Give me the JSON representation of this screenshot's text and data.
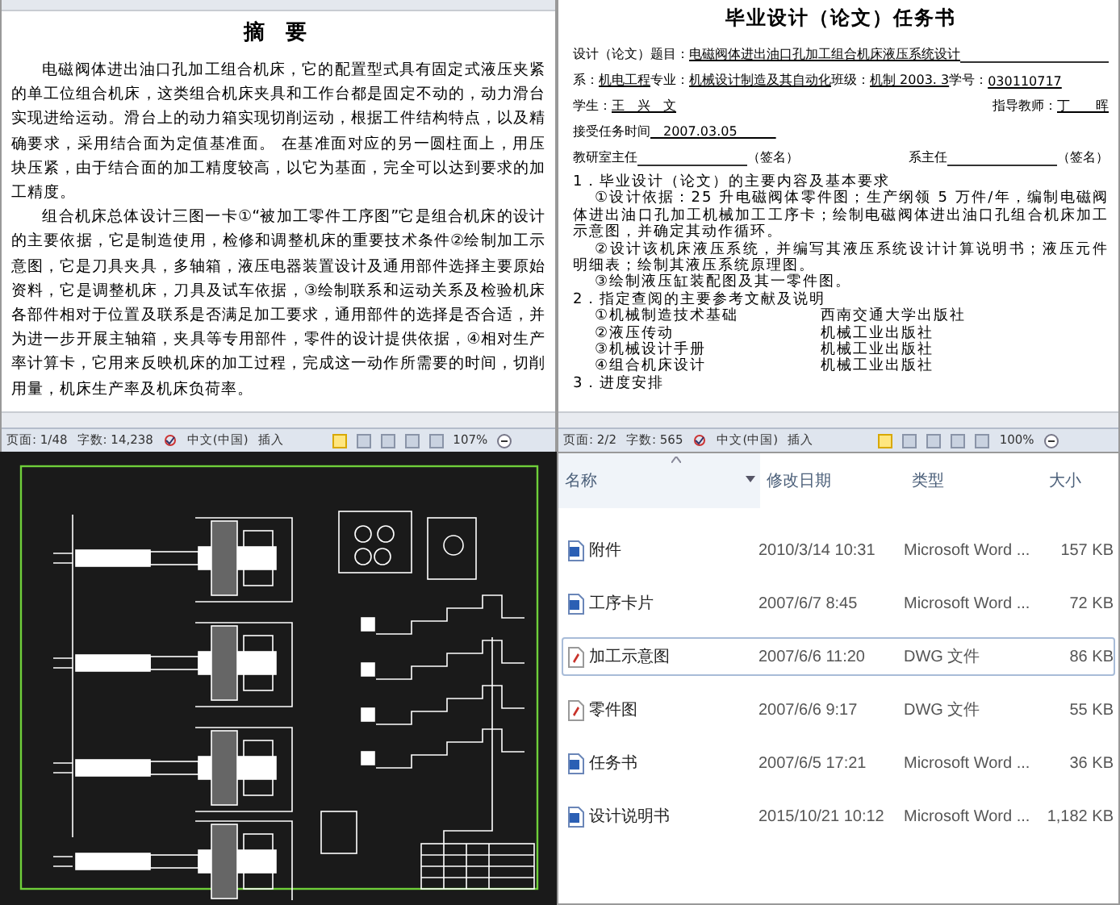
{
  "abstract_doc": {
    "title": "摘 要",
    "paragraphs": [
      "电磁阀体进出油口孔加工组合机床，它的配置型式具有固定式液压夹紧的单工位组合机床，这类组合机床夹具和工作台都是固定不动的，动力滑台实现进给运动。滑台上的动力箱实现切削运动，根据工件结构特点，以及精确要求，采用结合面为定值基准面。 在基准面对应的另一圆柱面上，用压块压紧，由于结合面的加工精度较高，以它为基面，完全可以达到要求的加工精度。",
      "组合机床总体设计三图一卡①“被加工零件工序图”它是组合机床的设计的主要依据，它是制造使用，检修和调整机床的重要技术条件②绘制加工示意图，它是刀具夹具，多轴箱，液压电器装置设计及通用部件选择主要原始资料，它是调整机床，刀具及试车依据，③绘制联系和运动关系及检验机床各部件相对于位置及联系是否满足加工要求，通用部件的选择是否合适，并为进一步开展主轴箱，夹具等专用部件，零件的设计提供依据，④相对生产率计算卡，它用来反映机床的加工过程，完成这一动作所需要的时间，切削用量，机床生产率及机床负荷率。"
    ],
    "status_bar": {
      "page": "页面: 1/48",
      "words": "字数: 14,238",
      "language": "中文(中国)",
      "mode": "插入",
      "zoom": "107%",
      "view_modes": [
        {
          "selected": true
        },
        {
          "selected": false
        },
        {
          "selected": false
        },
        {
          "selected": false
        },
        {
          "selected": false
        }
      ]
    }
  },
  "task_doc": {
    "title": "毕业设计（论文）任务书",
    "fields": [
      [
        {
          "kind": "text",
          "text": "设计（论文）题目："
        },
        {
          "kind": "filled",
          "text": "电磁阀体进出油口孔加工组合机床液压系统设计"
        },
        {
          "kind": "blank"
        }
      ],
      [
        {
          "kind": "text",
          "text": "系："
        },
        {
          "kind": "filled",
          "text": "机电工程"
        },
        {
          "kind": "text",
          "text": "专业："
        },
        {
          "kind": "filled",
          "text": "机械设计制造及其自动化"
        },
        {
          "kind": "text",
          "text": "班级："
        },
        {
          "kind": "filled",
          "text": "机制 2003. 3"
        },
        {
          "kind": "text",
          "text": " 学号："
        },
        {
          "kind": "filled",
          "text": "030110717"
        }
      ],
      [
        {
          "kind": "text",
          "text": "学生："
        },
        {
          "kind": "filled",
          "text": "王　兴　文"
        },
        {
          "kind": "gap"
        },
        {
          "kind": "text",
          "text": "指导教师："
        },
        {
          "kind": "filled",
          "text": "丁　　晖"
        }
      ],
      [
        {
          "kind": "text",
          "text": "接受任务时间"
        },
        {
          "kind": "filled",
          "text": "　2007.03.05　　　"
        }
      ],
      [
        {
          "kind": "text",
          "text": "教研室主任"
        },
        {
          "kind": "blank"
        },
        {
          "kind": "text",
          "text": "（签名）"
        },
        {
          "kind": "gap"
        },
        {
          "kind": "text",
          "text": "系主任"
        },
        {
          "kind": "blank"
        },
        {
          "kind": "text",
          "text": "（签名）"
        }
      ]
    ],
    "content": [
      {
        "kind": "heading",
        "text": "1．毕业设计（论文）的主要内容及基本要求"
      },
      {
        "kind": "item",
        "text": "①设计依据：25 升电磁阀体零件图；生产纲领 5 万件/年，编制电磁阀体进出油口孔加工机械加工工序卡；绘制电磁阀体进出油口孔组合机床加工示意图，并确定其动作循环。"
      },
      {
        "kind": "item",
        "text": "②设计该机床液压系统，并编写其液压系统设计计算说明书；液压元件明细表；绘制其液压系统原理图。"
      },
      {
        "kind": "item",
        "text": "③绘制液压缸装配图及其一零件图。"
      },
      {
        "kind": "heading",
        "text": "2．指定查阅的主要参考文献及说明"
      },
      {
        "kind": "reference",
        "text": "①机械制造技术基础",
        "publisher": "西南交通大学出版社"
      },
      {
        "kind": "reference",
        "text": "②液压传动",
        "publisher": "机械工业出版社"
      },
      {
        "kind": "reference",
        "text": "③机械设计手册",
        "publisher": "机械工业出版社"
      },
      {
        "kind": "reference",
        "text": "④组合机床设计",
        "publisher": "机械工业出版社"
      },
      {
        "kind": "heading",
        "text": "3．进度安排"
      }
    ],
    "status_bar": {
      "page": "页面: 2/2",
      "words": "字数: 565",
      "language": "中文(中国)",
      "mode": "插入",
      "zoom": "100%",
      "view_modes": [
        {
          "selected": true
        },
        {
          "selected": false
        },
        {
          "selected": false
        },
        {
          "selected": false
        },
        {
          "selected": false
        }
      ]
    }
  },
  "file_list": {
    "columns": [
      "名称",
      "修改日期",
      "类型",
      "大小"
    ],
    "rows": [
      {
        "name": "附件",
        "date": "2010/3/14 10:31",
        "type": "Microsoft Word ...",
        "size": "157 KB",
        "kind": "word",
        "selected": false
      },
      {
        "name": "工序卡片",
        "date": "2007/6/7 8:45",
        "type": "Microsoft Word ...",
        "size": "72 KB",
        "kind": "word",
        "selected": false
      },
      {
        "name": "加工示意图",
        "date": "2007/6/6 11:20",
        "type": "DWG 文件",
        "size": "86 KB",
        "kind": "dwg",
        "selected": true
      },
      {
        "name": "零件图",
        "date": "2007/6/6 9:17",
        "type": "DWG 文件",
        "size": "55 KB",
        "kind": "dwg",
        "selected": false
      },
      {
        "name": "任务书",
        "date": "2007/6/5 17:21",
        "type": "Microsoft Word ...",
        "size": "36 KB",
        "kind": "word",
        "selected": false
      },
      {
        "name": "设计说明书",
        "date": "2015/10/21 10:12",
        "type": "Microsoft Word ...",
        "size": "1,182 KB",
        "kind": "word",
        "selected": false
      }
    ]
  }
}
